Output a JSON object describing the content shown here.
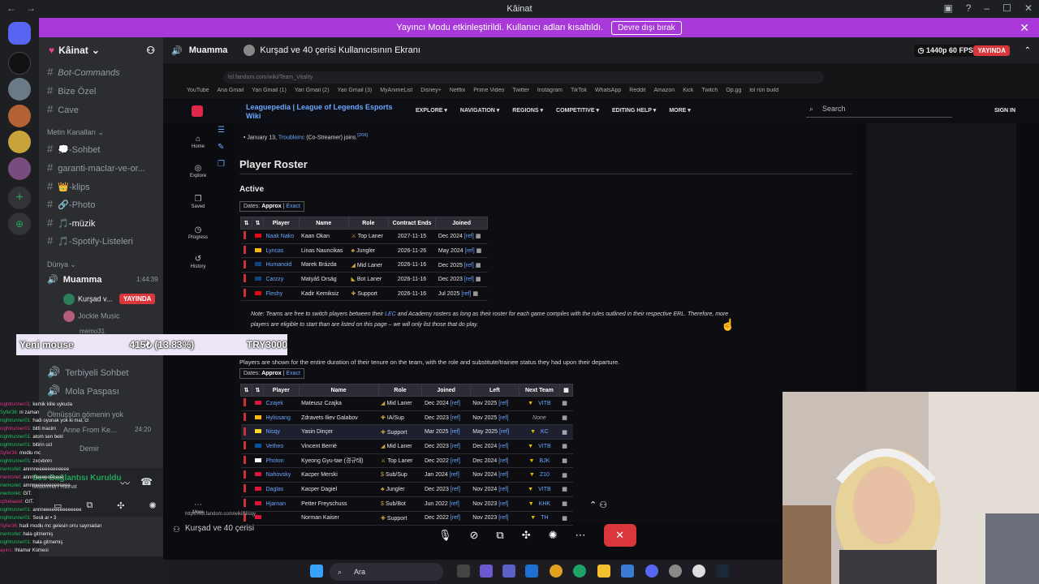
{
  "window": {
    "title": "Kâinat"
  },
  "banner": {
    "text": "Yayıncı Modu etkinleştirildi. Kullanıcı adları kısaltıldı.",
    "button": "Devre dışı bırak"
  },
  "sidebar": {
    "server_name": "Kâinat",
    "top_channels": [
      "Bot-Commands",
      "Bize Özel",
      "Cave"
    ],
    "text_category": "Metin Kanalları",
    "text_channels": [
      "💭-Sohbet",
      "garanti-maclar-ve-or...",
      "👑-klips",
      "🔗-Photo",
      "🎵-müzik",
      "🎵-Spotify-Listeleri"
    ],
    "voice_category": "Dünya",
    "voice_channel": "Muamma",
    "voice_time": "1:44:39",
    "voice_users": [
      "Kurşad v...",
      "Jockie Music",
      "memo31"
    ],
    "live_badge": "YAYINDA",
    "other_channels": [
      "Terbiyeli Sohbet",
      "Mola Paspası",
      "Ölmüşşün gömenin yok"
    ],
    "anne_user": "Anne From Ke...",
    "anne_time": "24:20",
    "demir_user": "Demir",
    "voice_status": "Ses Bağlantısı Kuruldu",
    "voice_sub": "Muamma / Kâinat"
  },
  "stream": {
    "channel": "Muamma",
    "title": "Kurşad ve 40 çerisi Kullanıcısının Ekranı",
    "quality": "1440p 60 FPS",
    "live": "YAYINDA"
  },
  "browser": {
    "url": "lol.fandom.com/wiki/Team_Vitality",
    "bookmarks": [
      "YouTube",
      "Ana Gmail",
      "Yan Gmail (1)",
      "Yan Gmail (2)",
      "Yan Gmail (3)",
      "MyAnimeList",
      "Disney+",
      "Netflix",
      "Prime Video",
      "Twitter",
      "Instagram",
      "TikTok",
      "WhatsApp",
      "Reddit",
      "Amazon",
      "Kick",
      "Twitch",
      "Op.gg",
      "lol rün build"
    ],
    "status_url": "https://lol.fandom.com/wiki/Nisqy"
  },
  "wiki": {
    "logo": "Leaguepedia | League of Legends Esports Wiki",
    "menus": [
      "EXPLORE ▾",
      "NAVIGATION ▾",
      "REGIONS ▾",
      "COMPETITIVE ▾",
      "EDITING HELP ▾",
      "MORE ▾"
    ],
    "search": "Search",
    "sign_in": "SIGN IN",
    "left_nav": [
      "Home",
      "Explore",
      "Saved",
      "Progress",
      "History",
      "More"
    ],
    "bullet": "January 13,",
    "bullet_link": "Troubleinc",
    "bullet_rest": "(Co-Streamer) joins.",
    "bullet_ref": "[206]",
    "section": "Player Roster",
    "subsection": "Active",
    "dates_label": "Dates:",
    "dates_approx": "Approx",
    "dates_exact": "Exact",
    "active_headers": [
      "Player",
      "Name",
      "Role",
      "Contract Ends",
      "Joined"
    ],
    "active_rows": [
      {
        "flag": "tr",
        "player": "Naak Nako",
        "name": "Kaan Okan",
        "role": "Top Laner",
        "contract": "2027-11-15",
        "joined": "Dec 2024"
      },
      {
        "flag": "lt",
        "player": "Lyncas",
        "name": "Linas Nauncikas",
        "role": "Jungler",
        "contract": "2026-11-26",
        "joined": "May 2024"
      },
      {
        "flag": "cz",
        "player": "Humanoid",
        "name": "Marek Brázda",
        "role": "Mid Laner",
        "contract": "2026-11-16",
        "joined": "Dec 2025"
      },
      {
        "flag": "cz",
        "player": "Carzzy",
        "name": "Matyáš Orság",
        "role": "Bot Laner",
        "contract": "2026-11-16",
        "joined": "Dec 2023"
      },
      {
        "flag": "tr",
        "player": "Fleshy",
        "name": "Kadir Kemiksiz",
        "role": "Support",
        "contract": "2026-11-16",
        "joined": "Jul 2025"
      }
    ],
    "ref": "[ref]",
    "note_prefix": "Note: Teams are free to switch players between their",
    "note_link": "LEC",
    "note_suffix": "and Academy rosters as long as their roster for each game compiles with the rules outlined in their respective ERL. Therefore, more players are eligible to start than are listed on this page – we will only list those that do play.",
    "former_para": "Players are shown for the entire duration of their tenure on the team, with the role and substitute/trainee status they had upon their departure.",
    "former_headers": [
      "Player",
      "Name",
      "Role",
      "Joined",
      "Left",
      "Next Team"
    ],
    "former_rows": [
      {
        "flag": "pl",
        "player": "Czajek",
        "name": "Mateusz Czajka",
        "role": "Mid Laner",
        "joined": "Dec 2024",
        "left": "Nov 2025",
        "next": "VITB"
      },
      {
        "flag": "lt",
        "player": "Hylissang",
        "name": "Zdravets Iliev Galabov",
        "role": "IA/Sup",
        "joined": "Dec 2023",
        "left": "Nov 2025",
        "next": "None"
      },
      {
        "flag": "be",
        "player": "Nisqy",
        "name": "Yasin Dinçer",
        "role": "Support",
        "joined": "Mar 2025",
        "left": "May 2025",
        "next": "KC"
      },
      {
        "flag": "fr",
        "player": "Vetheo",
        "name": "Vincent Berrié",
        "role": "Mid Laner",
        "joined": "Dec 2023",
        "left": "Dec 2024",
        "next": "VITB"
      },
      {
        "flag": "kr",
        "player": "Photon",
        "name": "Kyeong Gyu-tae (경규태)",
        "role": "Top Laner",
        "joined": "Dec 2022",
        "left": "Dec 2024",
        "next": "BJK"
      },
      {
        "flag": "pl",
        "player": "Nahovsky",
        "name": "Kacper Merski",
        "role": "Sub/Sup",
        "joined": "Jan 2024",
        "left": "Nov 2024",
        "next": "Z10"
      },
      {
        "flag": "pl",
        "player": "Daglas",
        "name": "Kacper Dagiel",
        "role": "Jungler",
        "joined": "Dec 2023",
        "left": "Nov 2024",
        "next": "VITB"
      },
      {
        "flag": "pl",
        "player": "Hjarnan",
        "name": "Petter Freyschuss",
        "role": "Sub/Bot",
        "joined": "Jun 2022",
        "left": "Nov 2023",
        "next": "KHK"
      },
      {
        "flag": "pl",
        "player": "",
        "name": "Norman Kaiser",
        "role": "Support",
        "joined": "Dec 2022",
        "left": "Nov 2023",
        "next": "TH"
      }
    ]
  },
  "overlay": {
    "product": "Yeni mouse",
    "price_change": "415₺ (13.83%)",
    "price": "TRY3000"
  },
  "chat": [
    {
      "user": "nightrunner01:",
      "msg": "kemik kille uykuda"
    },
    {
      "user": "Syfer36:",
      "msg": "ni zaman"
    },
    {
      "user": "nightrunner01:",
      "msg": "hadi oyunak yok ki mal, ct"
    },
    {
      "user": "nightrunner01:",
      "msg": "bitti macim"
    },
    {
      "user": "nightrunner01:",
      "msg": "atom sen bekl"
    },
    {
      "user": "nightrunner01:",
      "msg": "bitirin ucl"
    },
    {
      "user": "Syfer36:",
      "msg": "modlu mc"
    },
    {
      "user": "nightrunner01:",
      "msg": "zxcvbnm"
    },
    {
      "user": "memorlet:",
      "msg": "annnneeeeeeeeeeee"
    },
    {
      "user": "memorlet:",
      "msg": "annnneeeeeeeeee"
    },
    {
      "user": "memorlet:",
      "msg": "amnneeeeeeeeeeeee"
    },
    {
      "user": "memorlet:",
      "msg": "GIT."
    },
    {
      "user": "cpbelaaxd:",
      "msg": "GIT."
    },
    {
      "user": "nightrunner01:",
      "msg": "annneeeeeeeeeeeeee"
    },
    {
      "user": "nightrunner01:",
      "msg": "Sesli ar • 3"
    },
    {
      "user": "Syfer36:",
      "msg": "hadi modlu mc gelesin orru saymadan"
    },
    {
      "user": "memorlet:",
      "msg": "hala gitmemiş"
    },
    {
      "user": "nightrunner01:",
      "msg": "hala gitmemiş"
    },
    {
      "user": "ayırcı:",
      "msg": "Ihlamur Kümesi"
    }
  ],
  "userbar": {
    "name": "Kurşad ve 40 çerisi"
  },
  "taskbar": {
    "search": "Ara"
  },
  "colors": {
    "accent": "#a839d8",
    "live": "#da373c",
    "link": "#6aa7ff"
  }
}
